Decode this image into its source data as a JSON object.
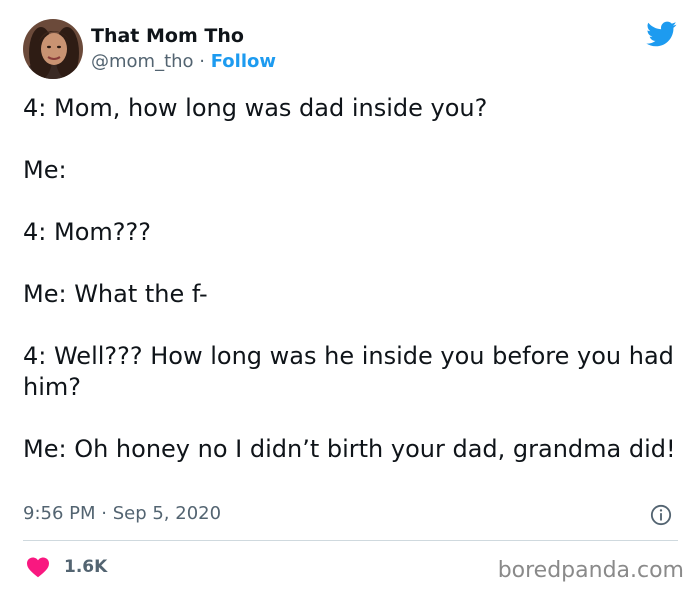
{
  "author": {
    "display_name": "That Mom Tho",
    "handle": "@mom_tho",
    "separator": " · ",
    "follow_label": "Follow"
  },
  "icons": {
    "brand": "twitter-bird-icon",
    "info": "info-icon",
    "like": "heart-icon"
  },
  "colors": {
    "twitter_blue": "#1d9bf0",
    "like_red": "#f91880",
    "text": "#0f1419",
    "secondary": "#536471"
  },
  "tweet": {
    "lines": [
      "4: Mom, how long was dad inside you?",
      "Me:",
      "4: Mom???",
      "Me: What the f-",
      "4: Well??? How long was he inside you before you had him?",
      "Me: Oh honey no I didn’t birth your dad, grandma did!"
    ],
    "time": "9:56 PM",
    "separator": " · ",
    "date": "Sep 5, 2020"
  },
  "engagement": {
    "likes": "1.6K"
  },
  "watermark": "boredpanda.com"
}
